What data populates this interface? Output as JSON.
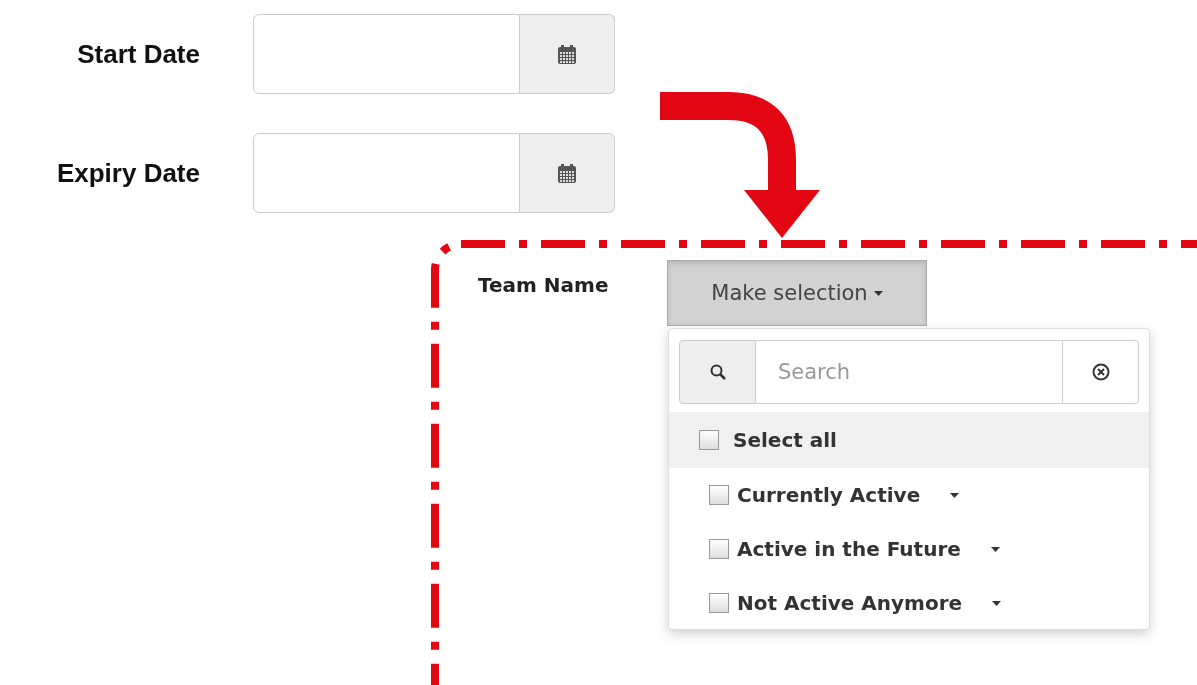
{
  "date_fields": [
    {
      "label": "Start Date"
    },
    {
      "label": "Expiry Date"
    }
  ],
  "team_filter": {
    "label": "Team Name",
    "button": "Make selection",
    "dropdown_open": true,
    "search": {
      "placeholder": "Search"
    },
    "select_all": {
      "label": "Select all",
      "checked": false
    },
    "groups": [
      {
        "label": "Currently Active",
        "checked": false
      },
      {
        "label": "Active in the Future",
        "checked": false
      },
      {
        "label": "Not Active Anymore",
        "checked": false
      }
    ]
  }
}
